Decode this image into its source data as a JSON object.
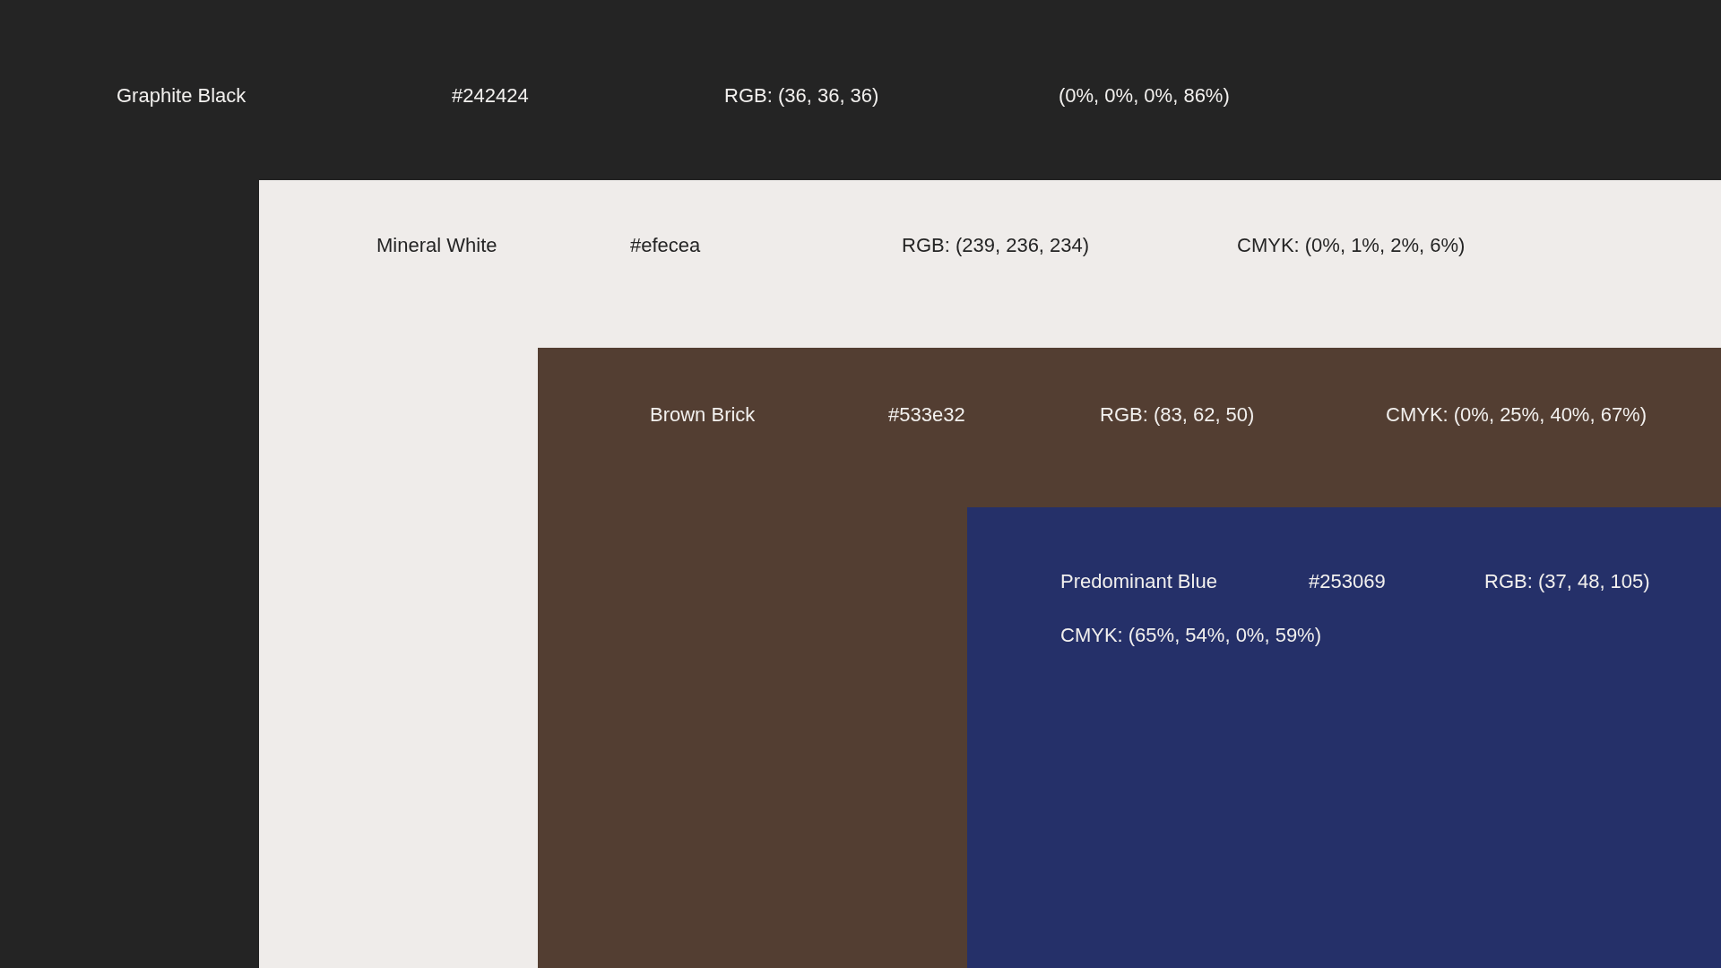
{
  "swatches": [
    {
      "name": "Graphite Black",
      "hex": "#242424",
      "rgb": "RGB: (36, 36, 36)",
      "cmyk": "(0%, 0%, 0%, 86%)",
      "color": "#242424"
    },
    {
      "name": "Mineral White",
      "hex": "#efecea",
      "rgb": "RGB: (239, 236, 234)",
      "cmyk": "CMYK: (0%, 1%, 2%, 6%)",
      "color": "#efecea"
    },
    {
      "name": "Brown Brick",
      "hex": "#533e32",
      "rgb": "RGB: (83, 62, 50)",
      "cmyk": "CMYK: (0%, 25%, 40%, 67%)",
      "color": "#533e32"
    },
    {
      "name": "Predominant Blue",
      "hex": "#253069",
      "rgb": "RGB: (37, 48, 105)",
      "cmyk": "CMYK: (65%, 54%, 0%, 59%)",
      "color": "#253069"
    }
  ]
}
